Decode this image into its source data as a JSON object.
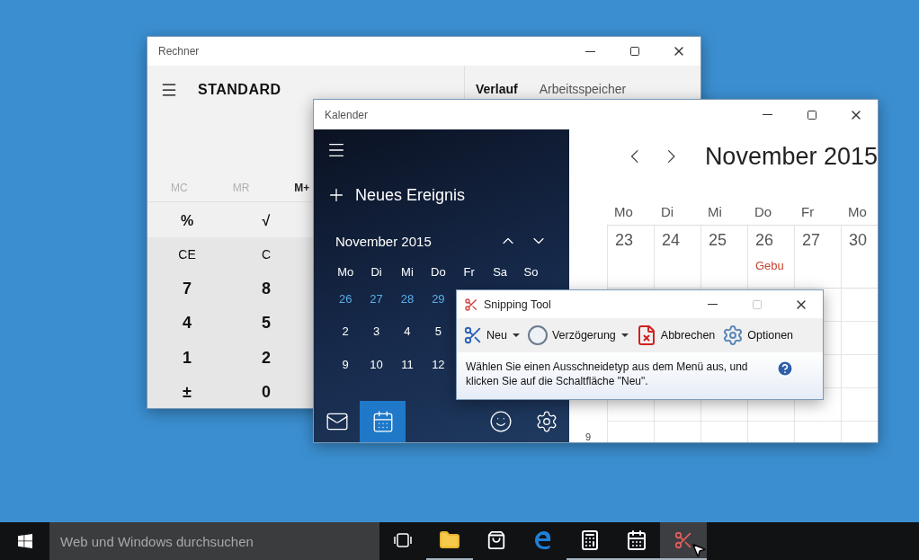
{
  "calculator": {
    "title": "Rechner",
    "controls": [
      {
        "kind": "minimize",
        "disabled": false
      },
      {
        "kind": "maximize",
        "disabled": false
      },
      {
        "kind": "close",
        "disabled": false
      }
    ],
    "mode": "STANDARD",
    "tabs": [
      {
        "label": "Verlauf",
        "selected": true
      },
      {
        "label": "Arbeitsspeicher",
        "selected": false
      }
    ],
    "memory": [
      {
        "label": "MC",
        "disabled": true
      },
      {
        "label": "MR",
        "disabled": true
      },
      {
        "label": "M+",
        "disabled": false
      }
    ],
    "keys": [
      [
        {
          "label": "%",
          "kind": "function"
        },
        {
          "label": "√",
          "kind": "function"
        }
      ],
      [
        {
          "label": "CE",
          "kind": "clear"
        },
        {
          "label": "C",
          "kind": "clear"
        }
      ],
      [
        {
          "label": "7",
          "kind": "digit"
        },
        {
          "label": "8",
          "kind": "digit"
        }
      ],
      [
        {
          "label": "4",
          "kind": "digit"
        },
        {
          "label": "5",
          "kind": "digit"
        }
      ],
      [
        {
          "label": "1",
          "kind": "digit"
        },
        {
          "label": "2",
          "kind": "digit"
        }
      ],
      [
        {
          "label": "±",
          "kind": "digit"
        },
        {
          "label": "0",
          "kind": "digit"
        }
      ]
    ]
  },
  "calendar": {
    "title": "Kalender",
    "controls": [
      {
        "kind": "minimize",
        "disabled": false
      },
      {
        "kind": "maximize",
        "disabled": false
      },
      {
        "kind": "close",
        "disabled": false
      }
    ],
    "new_event": "Neues Ereignis",
    "mini": {
      "month": "November 2015",
      "weekdays": [
        "Mo",
        "Di",
        "Mi",
        "Do",
        "Fr",
        "Sa",
        "So"
      ],
      "weeks": [
        [
          {
            "day": "26",
            "other_month": true
          },
          {
            "day": "27",
            "other_month": true
          },
          {
            "day": "28",
            "other_month": true
          },
          {
            "day": "29",
            "other_month": true
          }
        ],
        [
          {
            "day": "2",
            "other_month": false
          },
          {
            "day": "3",
            "other_month": false
          },
          {
            "day": "4",
            "other_month": false
          },
          {
            "day": "5",
            "other_month": false
          }
        ],
        [
          {
            "day": "9",
            "other_month": false
          },
          {
            "day": "10",
            "other_month": false
          },
          {
            "day": "11",
            "other_month": false
          },
          {
            "day": "12",
            "other_month": false
          }
        ]
      ]
    },
    "nav": [
      {
        "kind": "mail",
        "selected": false
      },
      {
        "kind": "calendar",
        "selected": true
      },
      {
        "kind": "feedback",
        "selected": false
      },
      {
        "kind": "settings",
        "selected": false
      }
    ],
    "main": {
      "month": "November 2015",
      "weekdays": [
        "Mo",
        "Di",
        "Mi",
        "Do",
        "Fr",
        "Mo"
      ],
      "days": [
        {
          "day": "23"
        },
        {
          "day": "24"
        },
        {
          "day": "25"
        },
        {
          "day": "26",
          "events": [
            {
              "title": "Gebu",
              "color": "#c5442e"
            }
          ]
        },
        {
          "day": "27"
        },
        {
          "day": "30"
        }
      ],
      "hour": "9"
    }
  },
  "snipping_tool": {
    "title": "Snipping Tool",
    "controls": [
      {
        "kind": "minimize",
        "disabled": false
      },
      {
        "kind": "maximize",
        "disabled": true
      },
      {
        "kind": "close",
        "disabled": false
      }
    ],
    "toolbar": [
      {
        "label": "Neu",
        "kind": "new",
        "dropdown": true
      },
      {
        "label": "Verzögerung",
        "kind": "delay",
        "dropdown": true
      },
      {
        "label": "Abbrechen",
        "kind": "cancel",
        "dropdown": false
      },
      {
        "label": "Optionen",
        "kind": "options",
        "dropdown": false
      }
    ],
    "message": "Wählen Sie einen Ausschneidetyp aus dem Menü aus, und klicken Sie auf die Schaltfläche \"Neu\"."
  },
  "taskbar": {
    "search_placeholder": "Web und Windows durchsuchen",
    "apps": [
      {
        "kind": "task-view",
        "running": false,
        "active": false
      },
      {
        "kind": "explorer",
        "running": true,
        "active": false
      },
      {
        "kind": "store",
        "running": false,
        "active": false
      },
      {
        "kind": "edge",
        "running": false,
        "active": false
      },
      {
        "kind": "calculator",
        "running": true,
        "active": false
      },
      {
        "kind": "calendar",
        "running": true,
        "active": false
      },
      {
        "kind": "snipping",
        "running": true,
        "active": true
      }
    ]
  }
}
